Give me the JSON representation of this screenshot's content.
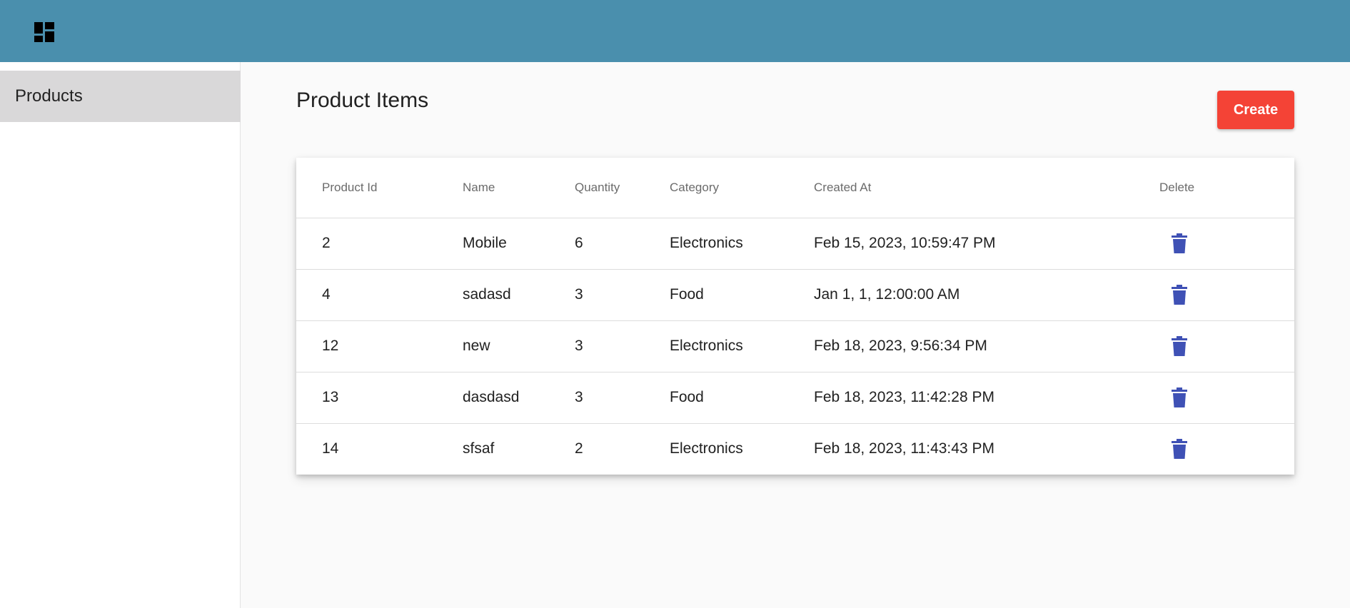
{
  "header": {
    "menu_icon": "dashboard-icon"
  },
  "sidebar": {
    "items": [
      {
        "label": "Products"
      }
    ]
  },
  "main": {
    "title": "Product Items",
    "create_label": "Create",
    "table": {
      "columns": [
        "Product Id",
        "Name",
        "Quantity",
        "Category",
        "Created At",
        "Delete"
      ],
      "rows": [
        {
          "id": "2",
          "name": "Mobile",
          "quantity": "6",
          "category": "Electronics",
          "created_at": "Feb 15, 2023, 10:59:47 PM"
        },
        {
          "id": "4",
          "name": "sadasd",
          "quantity": "3",
          "category": "Food",
          "created_at": "Jan 1, 1, 12:00:00 AM"
        },
        {
          "id": "12",
          "name": "new",
          "quantity": "3",
          "category": "Electronics",
          "created_at": "Feb 18, 2023, 9:56:34 PM"
        },
        {
          "id": "13",
          "name": "dasdasd",
          "quantity": "3",
          "category": "Food",
          "created_at": "Feb 18, 2023, 11:42:28 PM"
        },
        {
          "id": "14",
          "name": "sfsaf",
          "quantity": "2",
          "category": "Electronics",
          "created_at": "Feb 18, 2023, 11:43:43 PM"
        }
      ]
    }
  },
  "colors": {
    "header_bg": "#4a8fad",
    "create_button": "#f44336",
    "delete_icon": "#3f51b5",
    "sidebar_selected": "#d9d8d9"
  },
  "icons": {
    "delete": "trash-icon"
  }
}
